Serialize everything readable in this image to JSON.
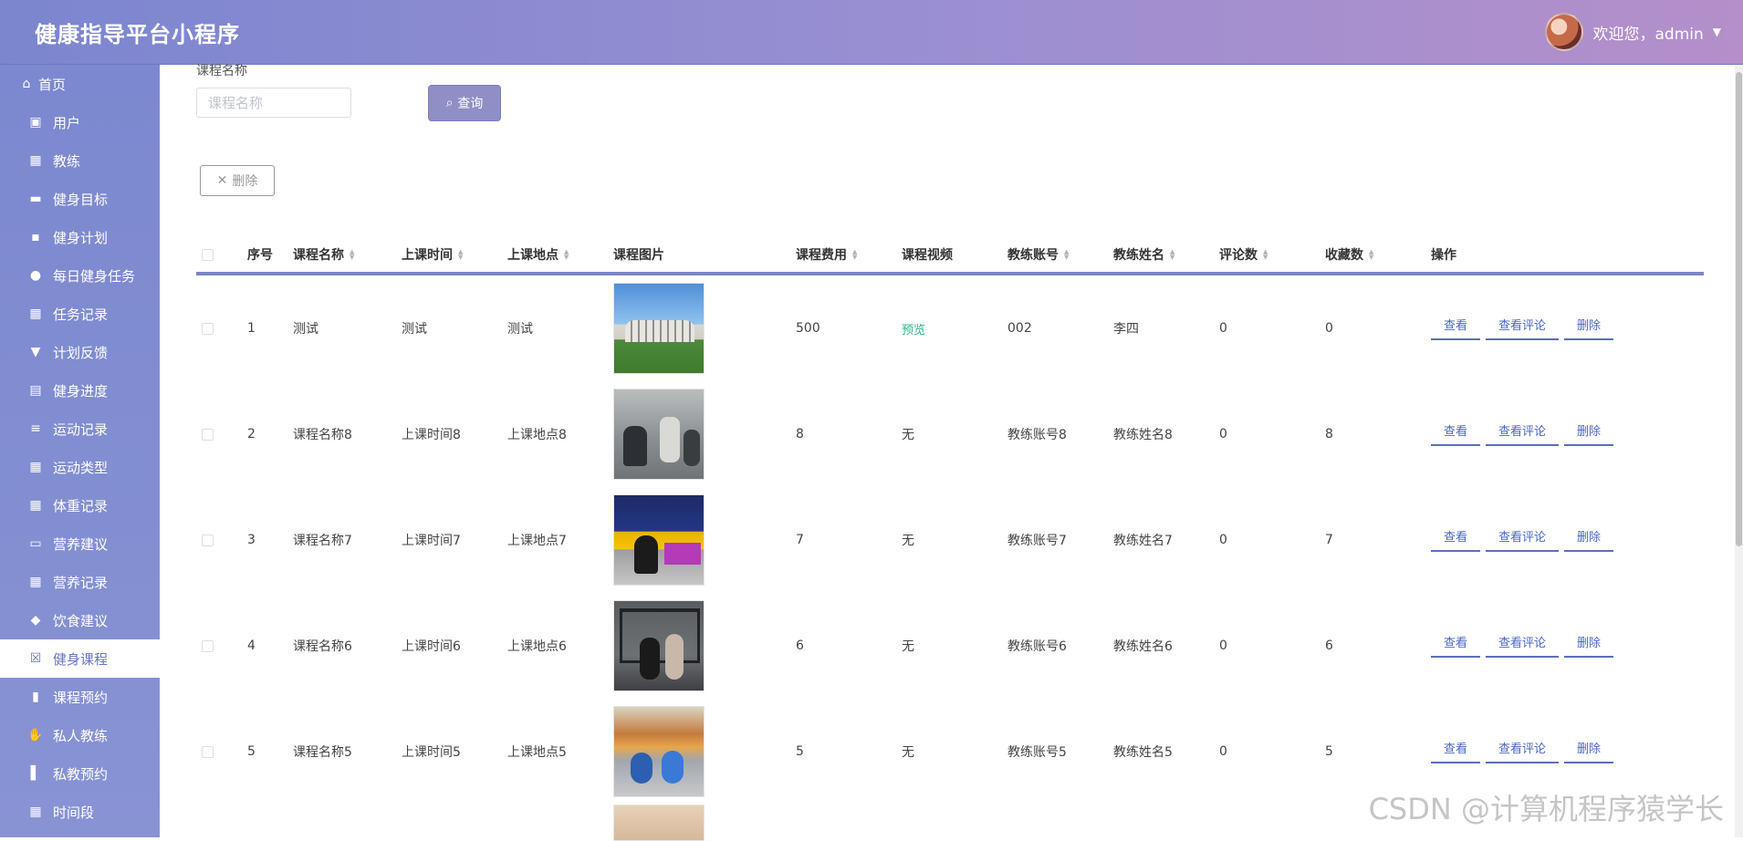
{
  "app": {
    "title": "健康指导平台小程序"
  },
  "user": {
    "greeting": "欢迎您，admin"
  },
  "sidebar": {
    "items": [
      {
        "label": "首页",
        "icon": "home-icon"
      },
      {
        "label": "用户",
        "icon": "clipboard-icon"
      },
      {
        "label": "教练",
        "icon": "grid-icon"
      },
      {
        "label": "健身目标",
        "icon": "briefcase-icon"
      },
      {
        "label": "健身计划",
        "icon": "chat-icon"
      },
      {
        "label": "每日健身任务",
        "icon": "bulb-icon"
      },
      {
        "label": "任务记录",
        "icon": "grid-icon"
      },
      {
        "label": "计划反馈",
        "icon": "marker-icon"
      },
      {
        "label": "健身进度",
        "icon": "table-icon"
      },
      {
        "label": "运动记录",
        "icon": "list-icon"
      },
      {
        "label": "运动类型",
        "icon": "grid-icon"
      },
      {
        "label": "体重记录",
        "icon": "grid-icon"
      },
      {
        "label": "营养建议",
        "icon": "print-icon"
      },
      {
        "label": "营养记录",
        "icon": "grid-icon"
      },
      {
        "label": "饮食建议",
        "icon": "user-icon"
      },
      {
        "label": "健身课程",
        "icon": "clipboard-x-icon",
        "active": true
      },
      {
        "label": "课程预约",
        "icon": "bar-chart-icon"
      },
      {
        "label": "私人教练",
        "icon": "hand-icon"
      },
      {
        "label": "私教预约",
        "icon": "book-icon"
      },
      {
        "label": "时间段",
        "icon": "grid-icon"
      }
    ]
  },
  "search": {
    "label": "课程名称",
    "placeholder": "课程名称",
    "value": "",
    "query_label": "查询"
  },
  "toolbar": {
    "delete_label": "删除"
  },
  "table": {
    "headers": {
      "index": "序号",
      "name": "课程名称",
      "time": "上课时间",
      "place": "上课地点",
      "image": "课程图片",
      "fee": "课程费用",
      "video": "课程视频",
      "coach_account": "教练账号",
      "coach_name": "教练姓名",
      "comments": "评论数",
      "favorites": "收藏数",
      "ops": "操作"
    },
    "rows": [
      {
        "index": "1",
        "name": "测试",
        "time": "测试",
        "place": "测试",
        "fee": "500",
        "video": "预览",
        "video_is_link": true,
        "coach_account": "002",
        "coach_name": "李四",
        "comments": "0",
        "favorites": "0"
      },
      {
        "index": "2",
        "name": "课程名称8",
        "time": "上课时间8",
        "place": "上课地点8",
        "fee": "8",
        "video": "无",
        "coach_account": "教练账号8",
        "coach_name": "教练姓名8",
        "comments": "0",
        "favorites": "8"
      },
      {
        "index": "3",
        "name": "课程名称7",
        "time": "上课时间7",
        "place": "上课地点7",
        "fee": "7",
        "video": "无",
        "coach_account": "教练账号7",
        "coach_name": "教练姓名7",
        "comments": "0",
        "favorites": "7"
      },
      {
        "index": "4",
        "name": "课程名称6",
        "time": "上课时间6",
        "place": "上课地点6",
        "fee": "6",
        "video": "无",
        "coach_account": "教练账号6",
        "coach_name": "教练姓名6",
        "comments": "0",
        "favorites": "6"
      },
      {
        "index": "5",
        "name": "课程名称5",
        "time": "上课时间5",
        "place": "上课地点5",
        "fee": "5",
        "video": "无",
        "coach_account": "教练账号5",
        "coach_name": "教练姓名5",
        "comments": "0",
        "favorites": "5"
      }
    ],
    "ops": {
      "view": "查看",
      "view_comments": "查看评论",
      "delete": "删除"
    }
  },
  "watermark": "CSDN @计算机程序猿学长"
}
